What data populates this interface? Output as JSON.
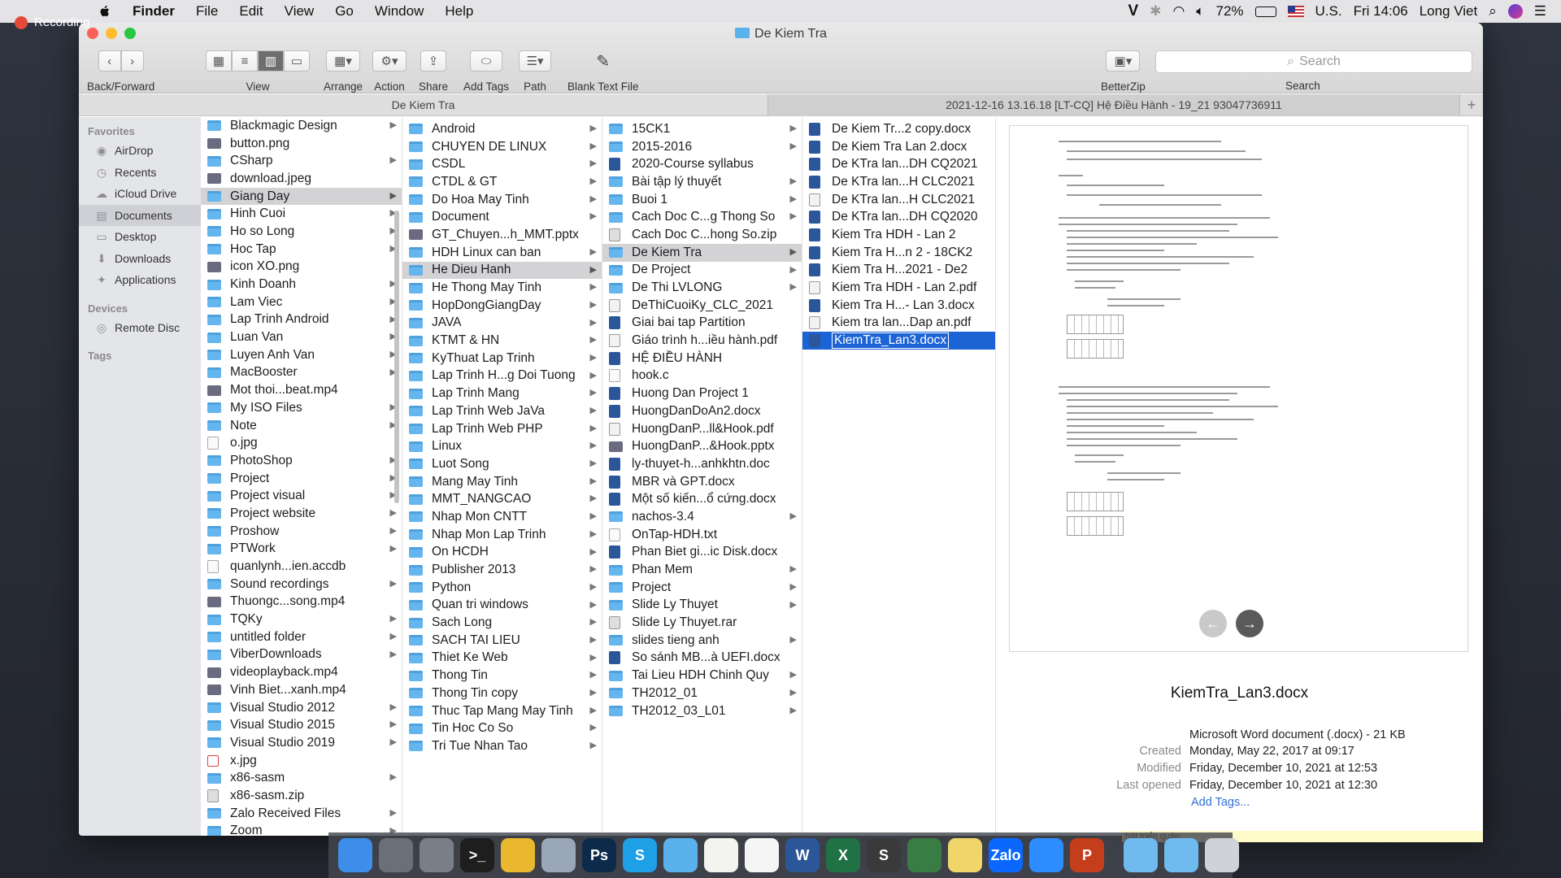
{
  "menubar": {
    "app": "Finder",
    "items": [
      "File",
      "Edit",
      "View",
      "Go",
      "Window",
      "Help"
    ],
    "status": {
      "v_icon": "V",
      "battery": "72%",
      "input": "U.S.",
      "clock": "Fri 14:06",
      "user": "Long Viet"
    }
  },
  "recording": {
    "label": "Recording"
  },
  "window": {
    "title": "De Kiem Tra",
    "toolbar": {
      "back_forward": "Back/Forward",
      "view": "View",
      "arrange": "Arrange",
      "action": "Action",
      "share": "Share",
      "add_tags": "Add Tags",
      "path": "Path",
      "blank_text_file": "Blank Text File",
      "betterzip": "BetterZip",
      "search_placeholder": "Search",
      "search_label": "Search"
    },
    "tabs": [
      "De Kiem Tra",
      "2021-12-16 13.16.18 [LT-CQ] Hệ Điều Hành - 19_21 93047736911"
    ]
  },
  "sidebar": {
    "favorites_header": "Favorites",
    "favorites": [
      {
        "label": "AirDrop",
        "icon": "airdrop-icon"
      },
      {
        "label": "Recents",
        "icon": "clock-icon"
      },
      {
        "label": "iCloud Drive",
        "icon": "cloud-icon"
      },
      {
        "label": "Documents",
        "icon": "documents-icon"
      },
      {
        "label": "Desktop",
        "icon": "desktop-icon"
      },
      {
        "label": "Downloads",
        "icon": "downloads-icon"
      },
      {
        "label": "Applications",
        "icon": "applications-icon"
      }
    ],
    "devices_header": "Devices",
    "devices": [
      {
        "label": "Remote Disc",
        "icon": "disc-icon"
      }
    ],
    "tags_header": "Tags"
  },
  "col1": [
    {
      "n": "Blackmagic Design",
      "t": "folder",
      "a": true
    },
    {
      "n": "button.png",
      "t": "img",
      "a": false
    },
    {
      "n": "CSharp",
      "t": "folder",
      "a": true
    },
    {
      "n": "download.jpeg",
      "t": "img",
      "a": false
    },
    {
      "n": "Giang Day",
      "t": "folder",
      "a": true,
      "sel": "g"
    },
    {
      "n": "Hinh Cuoi",
      "t": "folder",
      "a": true
    },
    {
      "n": "Ho so Long",
      "t": "folder",
      "a": true
    },
    {
      "n": "Hoc Tap",
      "t": "folder",
      "a": true
    },
    {
      "n": "icon XO.png",
      "t": "img",
      "a": false
    },
    {
      "n": "Kinh Doanh",
      "t": "folder",
      "a": true
    },
    {
      "n": "Lam Viec",
      "t": "folder",
      "a": true
    },
    {
      "n": "Lap Trinh Android",
      "t": "folder",
      "a": true
    },
    {
      "n": "Luan Van",
      "t": "folder",
      "a": true
    },
    {
      "n": "Luyen Anh Van",
      "t": "folder",
      "a": true
    },
    {
      "n": "MacBooster",
      "t": "folder",
      "a": true
    },
    {
      "n": "Mot thoi...beat.mp4",
      "t": "img",
      "a": false
    },
    {
      "n": "My ISO Files",
      "t": "folder",
      "a": true
    },
    {
      "n": "Note",
      "t": "folder",
      "a": true
    },
    {
      "n": "o.jpg",
      "t": "file",
      "a": false
    },
    {
      "n": "PhotoShop",
      "t": "folder",
      "a": true
    },
    {
      "n": "Project",
      "t": "folder",
      "a": true
    },
    {
      "n": "Project visual",
      "t": "folder",
      "a": true
    },
    {
      "n": "Project website",
      "t": "folder",
      "a": true
    },
    {
      "n": "Proshow",
      "t": "folder",
      "a": true
    },
    {
      "n": "PTWork",
      "t": "folder",
      "a": true
    },
    {
      "n": "quanlynh...ien.accdb",
      "t": "file",
      "a": false
    },
    {
      "n": "Sound recordings",
      "t": "folder",
      "a": true
    },
    {
      "n": "Thuongc...song.mp4",
      "t": "img",
      "a": false
    },
    {
      "n": "TQKy",
      "t": "folder",
      "a": true
    },
    {
      "n": "untitled folder",
      "t": "folder",
      "a": true
    },
    {
      "n": "ViberDownloads",
      "t": "folder",
      "a": true
    },
    {
      "n": "videoplayback.mp4",
      "t": "img",
      "a": false
    },
    {
      "n": "Vinh Biet...xanh.mp4",
      "t": "img",
      "a": false
    },
    {
      "n": "Visual Studio 2012",
      "t": "folder",
      "a": true
    },
    {
      "n": "Visual Studio 2015",
      "t": "folder",
      "a": true
    },
    {
      "n": "Visual Studio 2019",
      "t": "folder",
      "a": true
    },
    {
      "n": "x.jpg",
      "t": "x",
      "a": false
    },
    {
      "n": "x86-sasm",
      "t": "folder",
      "a": true
    },
    {
      "n": "x86-sasm.zip",
      "t": "zip",
      "a": false
    },
    {
      "n": "Zalo Received Files",
      "t": "folder",
      "a": true
    },
    {
      "n": "Zoom",
      "t": "folder",
      "a": true
    }
  ],
  "col2": [
    {
      "n": "Android",
      "t": "folder",
      "a": true
    },
    {
      "n": "CHUYEN DE LINUX",
      "t": "folder",
      "a": true
    },
    {
      "n": "CSDL",
      "t": "folder",
      "a": true
    },
    {
      "n": "CTDL & GT",
      "t": "folder",
      "a": true
    },
    {
      "n": "Do Hoa May Tinh",
      "t": "folder",
      "a": true
    },
    {
      "n": "Document",
      "t": "folder",
      "a": true
    },
    {
      "n": "GT_Chuyen...h_MMT.pptx",
      "t": "img",
      "a": false
    },
    {
      "n": "HDH Linux can ban",
      "t": "folder",
      "a": true
    },
    {
      "n": "He Dieu Hanh",
      "t": "folder",
      "a": true,
      "sel": "g"
    },
    {
      "n": "He Thong May Tinh",
      "t": "folder",
      "a": true
    },
    {
      "n": "HopDongGiangDay",
      "t": "folder",
      "a": true
    },
    {
      "n": "JAVA",
      "t": "folder",
      "a": true
    },
    {
      "n": "KTMT & HN",
      "t": "folder",
      "a": true
    },
    {
      "n": "KyThuat Lap Trinh",
      "t": "folder",
      "a": true
    },
    {
      "n": "Lap Trinh H...g Doi Tuong",
      "t": "folder",
      "a": true
    },
    {
      "n": "Lap Trinh Mang",
      "t": "folder",
      "a": true
    },
    {
      "n": "Lap Trinh Web JaVa",
      "t": "folder",
      "a": true
    },
    {
      "n": "Lap Trinh Web PHP",
      "t": "folder",
      "a": true
    },
    {
      "n": "Linux",
      "t": "folder",
      "a": true
    },
    {
      "n": "Luot Song",
      "t": "folder",
      "a": true
    },
    {
      "n": "Mang May Tinh",
      "t": "folder",
      "a": true
    },
    {
      "n": "MMT_NANGCAO",
      "t": "folder",
      "a": true
    },
    {
      "n": "Nhap Mon CNTT",
      "t": "folder",
      "a": true
    },
    {
      "n": "Nhap Mon Lap Trinh",
      "t": "folder",
      "a": true
    },
    {
      "n": "On HCDH",
      "t": "folder",
      "a": true
    },
    {
      "n": "Publisher 2013",
      "t": "folder",
      "a": true
    },
    {
      "n": "Python",
      "t": "folder",
      "a": true
    },
    {
      "n": "Quan tri windows",
      "t": "folder",
      "a": true
    },
    {
      "n": "Sach Long",
      "t": "folder",
      "a": true
    },
    {
      "n": "SACH TAI LIEU",
      "t": "folder",
      "a": true
    },
    {
      "n": "Thiet Ke Web",
      "t": "folder",
      "a": true
    },
    {
      "n": "Thong Tin",
      "t": "folder",
      "a": true
    },
    {
      "n": "Thong Tin copy",
      "t": "folder",
      "a": true
    },
    {
      "n": "Thuc Tap Mang May Tinh",
      "t": "folder",
      "a": true
    },
    {
      "n": "Tin Hoc Co So",
      "t": "folder",
      "a": true
    },
    {
      "n": "Tri Tue Nhan Tao",
      "t": "folder",
      "a": true
    }
  ],
  "col3": [
    {
      "n": "15CK1",
      "t": "folder",
      "a": true
    },
    {
      "n": "2015-2016",
      "t": "folder",
      "a": true
    },
    {
      "n": "2020-Course syllabus",
      "t": "doc",
      "a": false
    },
    {
      "n": "Bài tập lý thuyết",
      "t": "folder",
      "a": true
    },
    {
      "n": "Buoi 1",
      "t": "folder",
      "a": true
    },
    {
      "n": "Cach Doc C...g Thong So",
      "t": "folder",
      "a": true
    },
    {
      "n": "Cach Doc C...hong So.zip",
      "t": "zip",
      "a": false
    },
    {
      "n": "De Kiem Tra",
      "t": "folder",
      "a": true,
      "sel": "g"
    },
    {
      "n": "De Project",
      "t": "folder",
      "a": true
    },
    {
      "n": "De Thi LVLONG",
      "t": "folder",
      "a": true
    },
    {
      "n": "DeThiCuoiKy_CLC_2021",
      "t": "pdf",
      "a": false
    },
    {
      "n": "Giai bai tap Partition",
      "t": "doc",
      "a": false
    },
    {
      "n": "Giáo trình h...iều hành.pdf",
      "t": "pdf",
      "a": false
    },
    {
      "n": "HỆ ĐIỀU HÀNH",
      "t": "doc",
      "a": false
    },
    {
      "n": "hook.c",
      "t": "file",
      "a": false
    },
    {
      "n": "Huong Dan Project 1",
      "t": "doc",
      "a": false
    },
    {
      "n": "HuongDanDoAn2.docx",
      "t": "doc",
      "a": false
    },
    {
      "n": "HuongDanP...ll&Hook.pdf",
      "t": "pdf",
      "a": false
    },
    {
      "n": "HuongDanP...&Hook.pptx",
      "t": "img",
      "a": false
    },
    {
      "n": "ly-thuyet-h...anhkhtn.doc",
      "t": "doc",
      "a": false
    },
    {
      "n": "MBR và GPT.docx",
      "t": "doc",
      "a": false
    },
    {
      "n": "Một số kiến...ổ cứng.docx",
      "t": "doc",
      "a": false
    },
    {
      "n": "nachos-3.4",
      "t": "folder",
      "a": true
    },
    {
      "n": "OnTap-HDH.txt",
      "t": "file",
      "a": false
    },
    {
      "n": "Phan Biet gi...ic Disk.docx",
      "t": "doc",
      "a": false
    },
    {
      "n": "Phan Mem",
      "t": "folder",
      "a": true
    },
    {
      "n": "Project",
      "t": "folder",
      "a": true
    },
    {
      "n": "Slide Ly Thuyet",
      "t": "folder",
      "a": true
    },
    {
      "n": "Slide Ly Thuyet.rar",
      "t": "zip",
      "a": false
    },
    {
      "n": "slides tieng anh",
      "t": "folder",
      "a": true
    },
    {
      "n": "So sánh MB...à UEFI.docx",
      "t": "doc",
      "a": false
    },
    {
      "n": "Tai Lieu HDH Chinh Quy",
      "t": "folder",
      "a": true
    },
    {
      "n": "TH2012_01",
      "t": "folder",
      "a": true
    },
    {
      "n": "TH2012_03_L01",
      "t": "folder",
      "a": true
    }
  ],
  "col4": [
    {
      "n": "De Kiem Tr...2 copy.docx",
      "t": "doc",
      "a": false
    },
    {
      "n": "De Kiem Tra Lan 2.docx",
      "t": "doc",
      "a": false
    },
    {
      "n": "De KTra lan...DH CQ2021",
      "t": "doc",
      "a": false
    },
    {
      "n": "De KTra lan...H CLC2021",
      "t": "doc",
      "a": false
    },
    {
      "n": "De KTra lan...H CLC2021",
      "t": "pdf",
      "a": false
    },
    {
      "n": "De KTra lan...DH CQ2020",
      "t": "doc",
      "a": false
    },
    {
      "n": "Kiem Tra HDH - Lan 2",
      "t": "doc",
      "a": false
    },
    {
      "n": "Kiem Tra H...n 2 - 18CK2",
      "t": "doc",
      "a": false
    },
    {
      "n": "Kiem Tra H...2021 - De2",
      "t": "doc",
      "a": false
    },
    {
      "n": "Kiem Tra HDH - Lan 2.pdf",
      "t": "pdf",
      "a": false
    },
    {
      "n": "Kiem Tra H...- Lan 3.docx",
      "t": "doc",
      "a": false
    },
    {
      "n": "Kiem tra lan...Dap an.pdf",
      "t": "pdf",
      "a": false
    },
    {
      "n": "KiemTra_Lan3.docx",
      "t": "doc",
      "a": false,
      "sel": "b"
    }
  ],
  "preview": {
    "filename": "KiemTra_Lan3.docx",
    "kind": "Microsoft Word document (.docx) - 21 KB",
    "created_label": "Created",
    "created": "Monday, May 22, 2017 at 09:17",
    "modified_label": "Modified",
    "modified": "Friday, December 10, 2021 at 12:53",
    "opened_label": "Last opened",
    "opened": "Friday, December 10, 2021 at 12:30",
    "add_tags": "Add Tags..."
  },
  "notification_strip": "hát triển quản:",
  "dock": [
    {
      "name": "finder-icon",
      "c": "#3d8ee8",
      "t": ""
    },
    {
      "name": "launchpad-icon",
      "c": "#6b6f78",
      "t": ""
    },
    {
      "name": "system-preferences-icon",
      "c": "#7a7f87",
      "t": ""
    },
    {
      "name": "terminal-icon",
      "c": "#1e1e1e",
      "t": ">_"
    },
    {
      "name": "chrome-icon",
      "c": "#e9b82f",
      "t": ""
    },
    {
      "name": "preview-icon",
      "c": "#9aa7b8",
      "t": ""
    },
    {
      "name": "photoshop-icon",
      "c": "#0e2a4a",
      "t": "Ps"
    },
    {
      "name": "skype-icon",
      "c": "#1e9fe6",
      "t": "S"
    },
    {
      "name": "folder-icon",
      "c": "#5ab2ec",
      "t": ""
    },
    {
      "name": "notes-icon",
      "c": "#f3f3f0",
      "t": ""
    },
    {
      "name": "textedit-icon",
      "c": "#f5f5f5",
      "t": ""
    },
    {
      "name": "word-icon",
      "c": "#2b579a",
      "t": "W"
    },
    {
      "name": "excel-icon",
      "c": "#207245",
      "t": "X"
    },
    {
      "name": "sublime-icon",
      "c": "#3a3a3a",
      "t": "S"
    },
    {
      "name": "android-studio-icon",
      "c": "#3a7d44",
      "t": ""
    },
    {
      "name": "stickies-icon",
      "c": "#f0d66a",
      "t": ""
    },
    {
      "name": "zalo-icon",
      "c": "#0a68ff",
      "t": "Zalo"
    },
    {
      "name": "zoom-icon",
      "c": "#2d8cff",
      "t": ""
    },
    {
      "name": "powerpoint-icon",
      "c": "#c43e1c",
      "t": "P"
    },
    {
      "name": "sep",
      "c": "",
      "t": ""
    },
    {
      "name": "downloads-stack-icon",
      "c": "#6fbbf0",
      "t": ""
    },
    {
      "name": "documents-stack-icon",
      "c": "#6fbbf0",
      "t": ""
    },
    {
      "name": "trash-icon",
      "c": "#cfd2d6",
      "t": ""
    }
  ]
}
